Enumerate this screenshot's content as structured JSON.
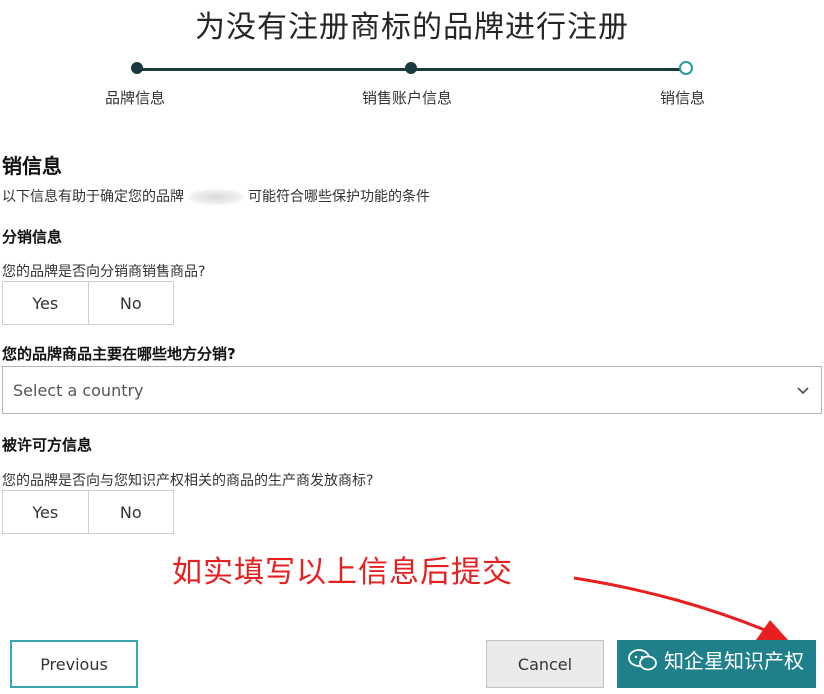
{
  "header": {
    "title": "为没有注册商标的品牌进行注册"
  },
  "stepper": {
    "steps": [
      {
        "label": "品牌信息",
        "state": "done"
      },
      {
        "label": "销售账户信息",
        "state": "done"
      },
      {
        "label": "销信息",
        "state": "current"
      }
    ]
  },
  "section": {
    "title": "销信息",
    "desc_before": "以下信息有助于确定您的品牌",
    "desc_after": "可能符合哪些保护功能的条件"
  },
  "distribution": {
    "heading": "分销信息",
    "question": "您的品牌是否向分销商销售商品?",
    "options": [
      "Yes",
      "No"
    ],
    "region_question": "您的品牌商品主要在哪些地方分销?",
    "country_placeholder": "Select a country"
  },
  "licensee": {
    "heading": "被许可方信息",
    "question": "您的品牌是否向与您知识产权相关的商品的生产商发放商标?",
    "options": [
      "Yes",
      "No"
    ]
  },
  "annotation": {
    "text": "如实填写以上信息后提交",
    "color": "#e62020"
  },
  "footer": {
    "previous_label": "Previous",
    "cancel_label": "Cancel"
  },
  "watermark": {
    "text": "知企星知识产权"
  },
  "colors": {
    "accent": "#1f7f8a",
    "stepper": "#1a3a3f",
    "annotation": "#e62020"
  }
}
